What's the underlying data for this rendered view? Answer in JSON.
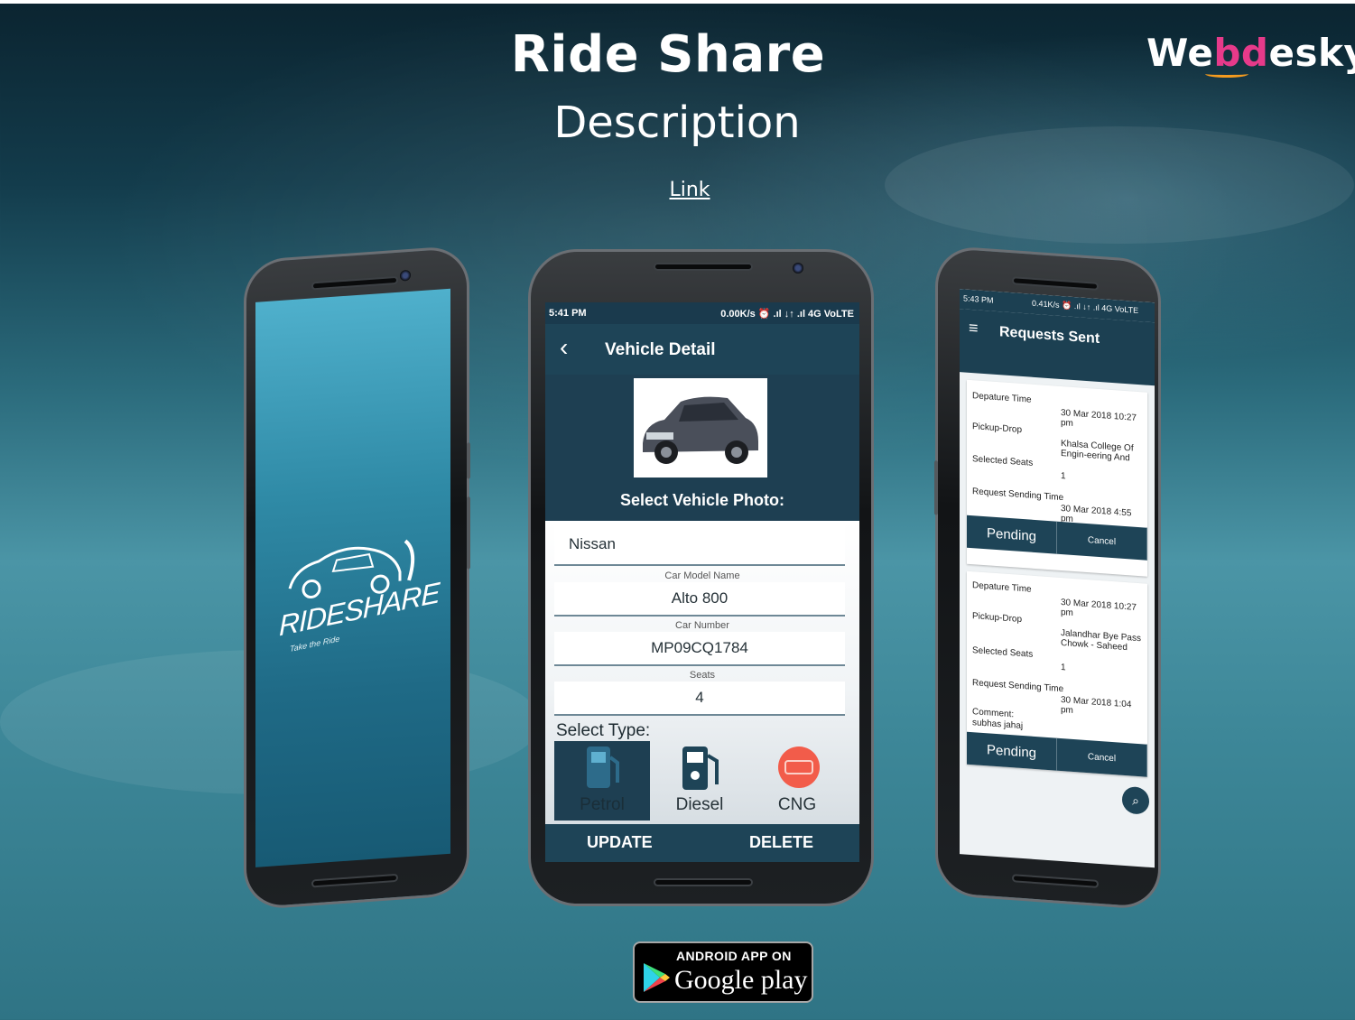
{
  "header": {
    "title": "Ride Share",
    "subtitle": "Description",
    "link": "Link",
    "brand": {
      "prefix": "We",
      "highlight": "bd",
      "suffix": "esky"
    }
  },
  "left_phone": {
    "logo_text": "RIDESHARE",
    "tagline": "Take the Ride"
  },
  "vehicle_detail": {
    "status": {
      "time": "5:41 PM",
      "right": "0.00K/s  ⏰  .ıl  ↓↑ .ıl 4G VoLTE"
    },
    "title": "Vehicle Detail",
    "photo_label": "Select Vehicle Photo:",
    "fields": [
      {
        "label": "",
        "value": "Nissan"
      },
      {
        "label": "Car Model Name",
        "value": "Alto 800"
      },
      {
        "label": "Car Number",
        "value": "MP09CQ1784"
      },
      {
        "label": "Seats",
        "value": "4"
      }
    ],
    "type_label": "Select Type:",
    "fuel_types": [
      {
        "name": "Petrol",
        "selected": true
      },
      {
        "name": "Diesel",
        "selected": false
      },
      {
        "name": "CNG",
        "selected": false
      }
    ],
    "actions": {
      "update": "UPDATE",
      "delete": "DELETE"
    },
    "colors": {
      "primary": "#1e4457",
      "selected": "#1e3f52",
      "cng": "#f25c4a"
    }
  },
  "requests_sent": {
    "status": {
      "time": "5:43 PM",
      "right": "0.41K/s ⏰ .ıl ↓↑ .ıl 4G VoLTE"
    },
    "title": "Requests Sent",
    "labels": {
      "departure": "Depature Time",
      "pickup": "Pickup-Drop",
      "seats": "Selected Seats",
      "sending": "Request Sending Time"
    },
    "cards": [
      {
        "departure": "30 Mar 2018 10:27 pm",
        "pickup": "Khalsa College Of Engin-eering And Technology",
        "seats": "1",
        "sending": "30 Mar 2018 4:55 pm",
        "comment": "",
        "status": "Pending",
        "cancel": "Cancel"
      },
      {
        "departure": "30 Mar 2018 10:27 pm",
        "pickup": "Jalandhar Bye Pass Chowk - Saheed Bhagat",
        "seats": "1",
        "sending": "30 Mar 2018 1:04 pm",
        "comment": "Comment: subhas jahaj",
        "status": "Pending",
        "cancel": "Cancel"
      }
    ]
  },
  "store_badge": {
    "small": "ANDROID APP ON",
    "big": "Google play"
  }
}
